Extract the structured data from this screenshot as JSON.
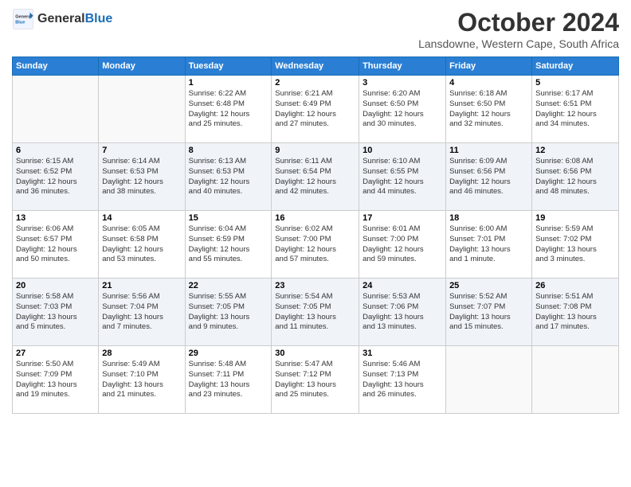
{
  "header": {
    "logo_general": "General",
    "logo_blue": "Blue",
    "month_title": "October 2024",
    "location": "Lansdowne, Western Cape, South Africa"
  },
  "days_of_week": [
    "Sunday",
    "Monday",
    "Tuesday",
    "Wednesday",
    "Thursday",
    "Friday",
    "Saturday"
  ],
  "weeks": [
    [
      {
        "day": "",
        "info": ""
      },
      {
        "day": "",
        "info": ""
      },
      {
        "day": "1",
        "info": "Sunrise: 6:22 AM\nSunset: 6:48 PM\nDaylight: 12 hours\nand 25 minutes."
      },
      {
        "day": "2",
        "info": "Sunrise: 6:21 AM\nSunset: 6:49 PM\nDaylight: 12 hours\nand 27 minutes."
      },
      {
        "day": "3",
        "info": "Sunrise: 6:20 AM\nSunset: 6:50 PM\nDaylight: 12 hours\nand 30 minutes."
      },
      {
        "day": "4",
        "info": "Sunrise: 6:18 AM\nSunset: 6:50 PM\nDaylight: 12 hours\nand 32 minutes."
      },
      {
        "day": "5",
        "info": "Sunrise: 6:17 AM\nSunset: 6:51 PM\nDaylight: 12 hours\nand 34 minutes."
      }
    ],
    [
      {
        "day": "6",
        "info": "Sunrise: 6:15 AM\nSunset: 6:52 PM\nDaylight: 12 hours\nand 36 minutes."
      },
      {
        "day": "7",
        "info": "Sunrise: 6:14 AM\nSunset: 6:53 PM\nDaylight: 12 hours\nand 38 minutes."
      },
      {
        "day": "8",
        "info": "Sunrise: 6:13 AM\nSunset: 6:53 PM\nDaylight: 12 hours\nand 40 minutes."
      },
      {
        "day": "9",
        "info": "Sunrise: 6:11 AM\nSunset: 6:54 PM\nDaylight: 12 hours\nand 42 minutes."
      },
      {
        "day": "10",
        "info": "Sunrise: 6:10 AM\nSunset: 6:55 PM\nDaylight: 12 hours\nand 44 minutes."
      },
      {
        "day": "11",
        "info": "Sunrise: 6:09 AM\nSunset: 6:56 PM\nDaylight: 12 hours\nand 46 minutes."
      },
      {
        "day": "12",
        "info": "Sunrise: 6:08 AM\nSunset: 6:56 PM\nDaylight: 12 hours\nand 48 minutes."
      }
    ],
    [
      {
        "day": "13",
        "info": "Sunrise: 6:06 AM\nSunset: 6:57 PM\nDaylight: 12 hours\nand 50 minutes."
      },
      {
        "day": "14",
        "info": "Sunrise: 6:05 AM\nSunset: 6:58 PM\nDaylight: 12 hours\nand 53 minutes."
      },
      {
        "day": "15",
        "info": "Sunrise: 6:04 AM\nSunset: 6:59 PM\nDaylight: 12 hours\nand 55 minutes."
      },
      {
        "day": "16",
        "info": "Sunrise: 6:02 AM\nSunset: 7:00 PM\nDaylight: 12 hours\nand 57 minutes."
      },
      {
        "day": "17",
        "info": "Sunrise: 6:01 AM\nSunset: 7:00 PM\nDaylight: 12 hours\nand 59 minutes."
      },
      {
        "day": "18",
        "info": "Sunrise: 6:00 AM\nSunset: 7:01 PM\nDaylight: 13 hours\nand 1 minute."
      },
      {
        "day": "19",
        "info": "Sunrise: 5:59 AM\nSunset: 7:02 PM\nDaylight: 13 hours\nand 3 minutes."
      }
    ],
    [
      {
        "day": "20",
        "info": "Sunrise: 5:58 AM\nSunset: 7:03 PM\nDaylight: 13 hours\nand 5 minutes."
      },
      {
        "day": "21",
        "info": "Sunrise: 5:56 AM\nSunset: 7:04 PM\nDaylight: 13 hours\nand 7 minutes."
      },
      {
        "day": "22",
        "info": "Sunrise: 5:55 AM\nSunset: 7:05 PM\nDaylight: 13 hours\nand 9 minutes."
      },
      {
        "day": "23",
        "info": "Sunrise: 5:54 AM\nSunset: 7:05 PM\nDaylight: 13 hours\nand 11 minutes."
      },
      {
        "day": "24",
        "info": "Sunrise: 5:53 AM\nSunset: 7:06 PM\nDaylight: 13 hours\nand 13 minutes."
      },
      {
        "day": "25",
        "info": "Sunrise: 5:52 AM\nSunset: 7:07 PM\nDaylight: 13 hours\nand 15 minutes."
      },
      {
        "day": "26",
        "info": "Sunrise: 5:51 AM\nSunset: 7:08 PM\nDaylight: 13 hours\nand 17 minutes."
      }
    ],
    [
      {
        "day": "27",
        "info": "Sunrise: 5:50 AM\nSunset: 7:09 PM\nDaylight: 13 hours\nand 19 minutes."
      },
      {
        "day": "28",
        "info": "Sunrise: 5:49 AM\nSunset: 7:10 PM\nDaylight: 13 hours\nand 21 minutes."
      },
      {
        "day": "29",
        "info": "Sunrise: 5:48 AM\nSunset: 7:11 PM\nDaylight: 13 hours\nand 23 minutes."
      },
      {
        "day": "30",
        "info": "Sunrise: 5:47 AM\nSunset: 7:12 PM\nDaylight: 13 hours\nand 25 minutes."
      },
      {
        "day": "31",
        "info": "Sunrise: 5:46 AM\nSunset: 7:13 PM\nDaylight: 13 hours\nand 26 minutes."
      },
      {
        "day": "",
        "info": ""
      },
      {
        "day": "",
        "info": ""
      }
    ]
  ]
}
